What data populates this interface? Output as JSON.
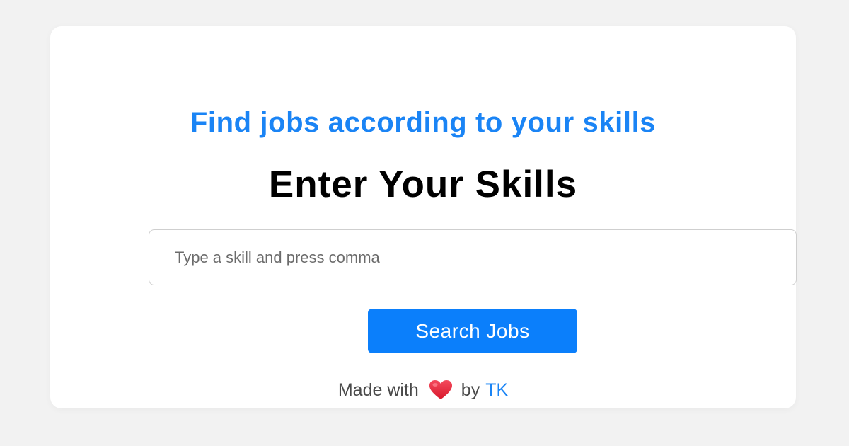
{
  "card": {
    "subtitle": "Find jobs according to your skills",
    "heading": "Enter Your Skills",
    "skill_input": {
      "placeholder": "Type a skill and press comma",
      "value": ""
    },
    "search_button_label": "Search Jobs",
    "footer": {
      "made_with": "Made with",
      "heart_icon": "heart-icon",
      "by": "by",
      "author": "TK"
    }
  },
  "colors": {
    "accent": "#1a84f5",
    "button": "#0b7ffb",
    "heart": "#e8263a",
    "background": "#f2f2f2"
  }
}
